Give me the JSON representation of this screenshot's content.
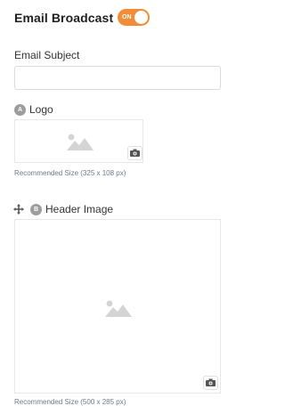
{
  "header": {
    "title": "Email Broadcast",
    "toggle_label": "ON"
  },
  "subject": {
    "label": "Email Subject",
    "value": "",
    "placeholder": ""
  },
  "logo": {
    "badge": "A",
    "label": "Logo",
    "hint": "Recommended Size (325 x 108 px)"
  },
  "header_image": {
    "badge": "B",
    "label": "Header Image",
    "hint": "Recommended Size (500 x 285 px)"
  },
  "colors": {
    "accent": "#f28c38",
    "badge": "#9d9d9d",
    "hint_text": "#6d7a86"
  },
  "icons": [
    "image-placeholder-icon",
    "camera-icon",
    "move-handle-icon"
  ]
}
